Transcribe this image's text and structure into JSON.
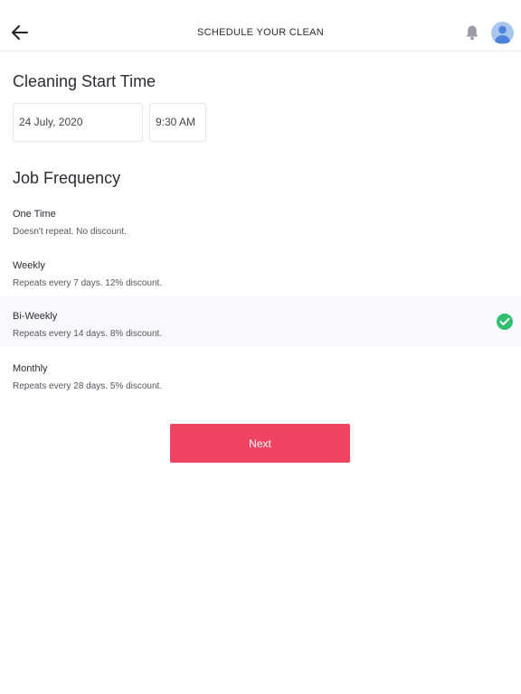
{
  "header": {
    "title": "SCHEDULE YOUR CLEAN"
  },
  "icons": {
    "back": "arrow-left-icon",
    "notifications": "bell-icon",
    "profile": "user-avatar-icon",
    "selected": "check-circle-icon"
  },
  "start_time": {
    "title": "Cleaning Start Time",
    "date": "24 July, 2020",
    "time": "9:30 AM"
  },
  "frequency": {
    "title": "Job Frequency",
    "selected": "Bi-Weekly",
    "options": [
      {
        "name": "One Time",
        "description": "Doesn't repeat. No discount."
      },
      {
        "name": "Weekly",
        "description": "Repeats every 7 days. 12% discount."
      },
      {
        "name": "Bi-Weekly",
        "description": "Repeats every 14 days. 8% discount."
      },
      {
        "name": "Monthly",
        "description": "Repeats every 28 days. 5% discount."
      }
    ]
  },
  "actions": {
    "next_label": "Next"
  },
  "colors": {
    "accent": "#ef4563",
    "success": "#2fbf71",
    "avatar": "#a9c6ee",
    "selected_row": "#f9f8fc"
  }
}
